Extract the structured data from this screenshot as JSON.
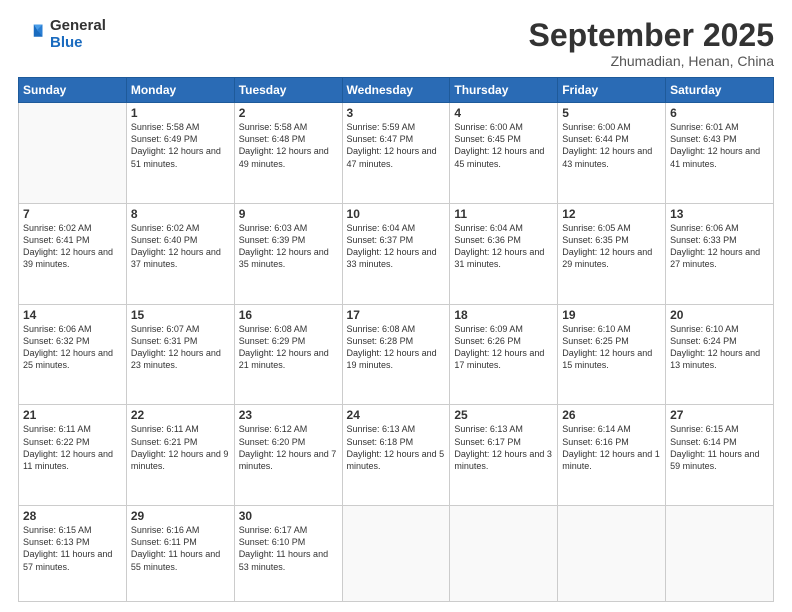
{
  "header": {
    "logo_general": "General",
    "logo_blue": "Blue",
    "month": "September 2025",
    "location": "Zhumadian, Henan, China"
  },
  "days_of_week": [
    "Sunday",
    "Monday",
    "Tuesday",
    "Wednesday",
    "Thursday",
    "Friday",
    "Saturday"
  ],
  "weeks": [
    [
      {
        "day": "",
        "sunrise": "",
        "sunset": "",
        "daylight": "",
        "empty": true
      },
      {
        "day": "1",
        "sunrise": "Sunrise: 5:58 AM",
        "sunset": "Sunset: 6:49 PM",
        "daylight": "Daylight: 12 hours and 51 minutes."
      },
      {
        "day": "2",
        "sunrise": "Sunrise: 5:58 AM",
        "sunset": "Sunset: 6:48 PM",
        "daylight": "Daylight: 12 hours and 49 minutes."
      },
      {
        "day": "3",
        "sunrise": "Sunrise: 5:59 AM",
        "sunset": "Sunset: 6:47 PM",
        "daylight": "Daylight: 12 hours and 47 minutes."
      },
      {
        "day": "4",
        "sunrise": "Sunrise: 6:00 AM",
        "sunset": "Sunset: 6:45 PM",
        "daylight": "Daylight: 12 hours and 45 minutes."
      },
      {
        "day": "5",
        "sunrise": "Sunrise: 6:00 AM",
        "sunset": "Sunset: 6:44 PM",
        "daylight": "Daylight: 12 hours and 43 minutes."
      },
      {
        "day": "6",
        "sunrise": "Sunrise: 6:01 AM",
        "sunset": "Sunset: 6:43 PM",
        "daylight": "Daylight: 12 hours and 41 minutes."
      }
    ],
    [
      {
        "day": "7",
        "sunrise": "Sunrise: 6:02 AM",
        "sunset": "Sunset: 6:41 PM",
        "daylight": "Daylight: 12 hours and 39 minutes."
      },
      {
        "day": "8",
        "sunrise": "Sunrise: 6:02 AM",
        "sunset": "Sunset: 6:40 PM",
        "daylight": "Daylight: 12 hours and 37 minutes."
      },
      {
        "day": "9",
        "sunrise": "Sunrise: 6:03 AM",
        "sunset": "Sunset: 6:39 PM",
        "daylight": "Daylight: 12 hours and 35 minutes."
      },
      {
        "day": "10",
        "sunrise": "Sunrise: 6:04 AM",
        "sunset": "Sunset: 6:37 PM",
        "daylight": "Daylight: 12 hours and 33 minutes."
      },
      {
        "day": "11",
        "sunrise": "Sunrise: 6:04 AM",
        "sunset": "Sunset: 6:36 PM",
        "daylight": "Daylight: 12 hours and 31 minutes."
      },
      {
        "day": "12",
        "sunrise": "Sunrise: 6:05 AM",
        "sunset": "Sunset: 6:35 PM",
        "daylight": "Daylight: 12 hours and 29 minutes."
      },
      {
        "day": "13",
        "sunrise": "Sunrise: 6:06 AM",
        "sunset": "Sunset: 6:33 PM",
        "daylight": "Daylight: 12 hours and 27 minutes."
      }
    ],
    [
      {
        "day": "14",
        "sunrise": "Sunrise: 6:06 AM",
        "sunset": "Sunset: 6:32 PM",
        "daylight": "Daylight: 12 hours and 25 minutes."
      },
      {
        "day": "15",
        "sunrise": "Sunrise: 6:07 AM",
        "sunset": "Sunset: 6:31 PM",
        "daylight": "Daylight: 12 hours and 23 minutes."
      },
      {
        "day": "16",
        "sunrise": "Sunrise: 6:08 AM",
        "sunset": "Sunset: 6:29 PM",
        "daylight": "Daylight: 12 hours and 21 minutes."
      },
      {
        "day": "17",
        "sunrise": "Sunrise: 6:08 AM",
        "sunset": "Sunset: 6:28 PM",
        "daylight": "Daylight: 12 hours and 19 minutes."
      },
      {
        "day": "18",
        "sunrise": "Sunrise: 6:09 AM",
        "sunset": "Sunset: 6:26 PM",
        "daylight": "Daylight: 12 hours and 17 minutes."
      },
      {
        "day": "19",
        "sunrise": "Sunrise: 6:10 AM",
        "sunset": "Sunset: 6:25 PM",
        "daylight": "Daylight: 12 hours and 15 minutes."
      },
      {
        "day": "20",
        "sunrise": "Sunrise: 6:10 AM",
        "sunset": "Sunset: 6:24 PM",
        "daylight": "Daylight: 12 hours and 13 minutes."
      }
    ],
    [
      {
        "day": "21",
        "sunrise": "Sunrise: 6:11 AM",
        "sunset": "Sunset: 6:22 PM",
        "daylight": "Daylight: 12 hours and 11 minutes."
      },
      {
        "day": "22",
        "sunrise": "Sunrise: 6:11 AM",
        "sunset": "Sunset: 6:21 PM",
        "daylight": "Daylight: 12 hours and 9 minutes."
      },
      {
        "day": "23",
        "sunrise": "Sunrise: 6:12 AM",
        "sunset": "Sunset: 6:20 PM",
        "daylight": "Daylight: 12 hours and 7 minutes."
      },
      {
        "day": "24",
        "sunrise": "Sunrise: 6:13 AM",
        "sunset": "Sunset: 6:18 PM",
        "daylight": "Daylight: 12 hours and 5 minutes."
      },
      {
        "day": "25",
        "sunrise": "Sunrise: 6:13 AM",
        "sunset": "Sunset: 6:17 PM",
        "daylight": "Daylight: 12 hours and 3 minutes."
      },
      {
        "day": "26",
        "sunrise": "Sunrise: 6:14 AM",
        "sunset": "Sunset: 6:16 PM",
        "daylight": "Daylight: 12 hours and 1 minute."
      },
      {
        "day": "27",
        "sunrise": "Sunrise: 6:15 AM",
        "sunset": "Sunset: 6:14 PM",
        "daylight": "Daylight: 11 hours and 59 minutes."
      }
    ],
    [
      {
        "day": "28",
        "sunrise": "Sunrise: 6:15 AM",
        "sunset": "Sunset: 6:13 PM",
        "daylight": "Daylight: 11 hours and 57 minutes."
      },
      {
        "day": "29",
        "sunrise": "Sunrise: 6:16 AM",
        "sunset": "Sunset: 6:11 PM",
        "daylight": "Daylight: 11 hours and 55 minutes."
      },
      {
        "day": "30",
        "sunrise": "Sunrise: 6:17 AM",
        "sunset": "Sunset: 6:10 PM",
        "daylight": "Daylight: 11 hours and 53 minutes."
      },
      {
        "day": "",
        "sunrise": "",
        "sunset": "",
        "daylight": "",
        "empty": true
      },
      {
        "day": "",
        "sunrise": "",
        "sunset": "",
        "daylight": "",
        "empty": true
      },
      {
        "day": "",
        "sunrise": "",
        "sunset": "",
        "daylight": "",
        "empty": true
      },
      {
        "day": "",
        "sunrise": "",
        "sunset": "",
        "daylight": "",
        "empty": true
      }
    ]
  ]
}
